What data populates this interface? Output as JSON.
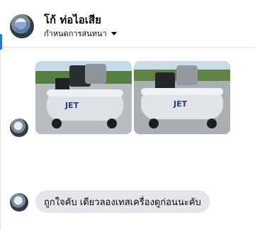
{
  "conversation": {
    "contact_name": "โก้ ท่อไอเสีย",
    "subtitle": "กำหนดการสนทนา"
  },
  "messages": [
    {
      "type": "photos",
      "count": 2,
      "photo_brand_text": "JET"
    },
    {
      "type": "text",
      "text": "ถูกใจคับ เดียวลองเทสเครื่องดูก่อนนะคับ"
    }
  ],
  "icons": {
    "subtitle_caret": "chevron-down-icon"
  },
  "colors": {
    "accent": "#1877f2",
    "bubble": "#e4e6eb",
    "text": "#050505"
  }
}
